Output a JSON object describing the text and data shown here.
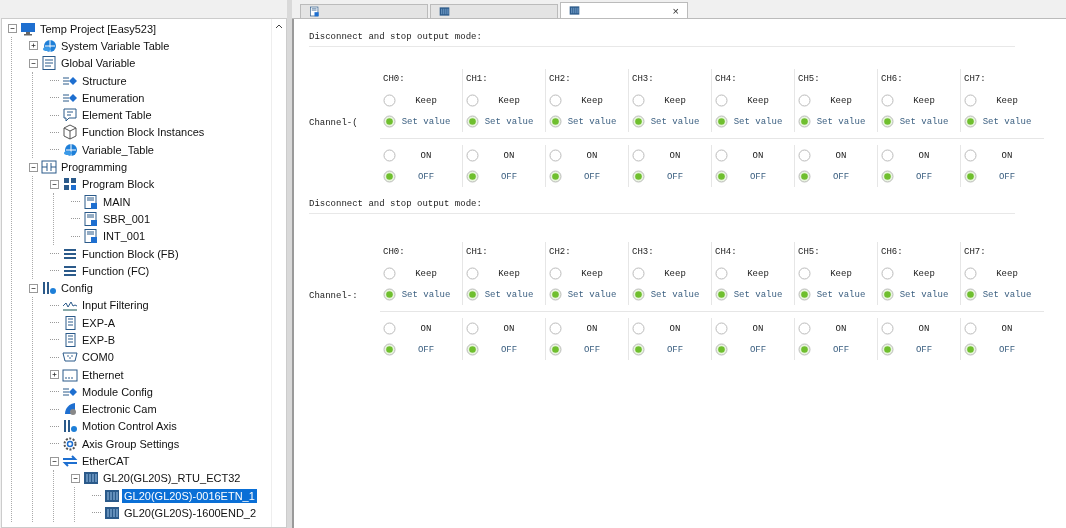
{
  "tabs": [
    {
      "selected": false
    },
    {
      "selected": false
    },
    {
      "selected": true,
      "close": "×"
    }
  ],
  "tree": [
    {
      "label": "Temp Project [Easy523]",
      "expanded": true,
      "selected": false,
      "children": [
        {
          "label": "System Variable Table",
          "expanded": false,
          "selected": false
        },
        {
          "label": "Global Variable",
          "expanded": true,
          "selected": false,
          "children": [
            {
              "label": "Structure",
              "selected": false
            },
            {
              "label": "Enumeration",
              "selected": false
            },
            {
              "label": "Element Table",
              "selected": false
            },
            {
              "label": "Function Block Instances",
              "selected": false
            },
            {
              "label": "Variable_Table",
              "selected": false
            }
          ]
        },
        {
          "label": "Programming",
          "expanded": true,
          "selected": false,
          "children": [
            {
              "label": "Program Block",
              "expanded": true,
              "selected": false,
              "children": [
                {
                  "label": "MAIN",
                  "selected": false
                },
                {
                  "label": "SBR_001",
                  "selected": false
                },
                {
                  "label": "INT_001",
                  "selected": false
                }
              ]
            },
            {
              "label": "Function Block (FB)",
              "selected": false
            },
            {
              "label": "Function (FC)",
              "selected": false
            }
          ]
        },
        {
          "label": "Config",
          "expanded": true,
          "selected": false,
          "children": [
            {
              "label": "Input Filtering",
              "selected": false
            },
            {
              "label": "EXP-A",
              "selected": false
            },
            {
              "label": "EXP-B",
              "selected": false
            },
            {
              "label": "COM0",
              "selected": false
            },
            {
              "label": "Ethernet",
              "expanded": false,
              "selected": false
            },
            {
              "label": "Module Config",
              "selected": false
            },
            {
              "label": "Electronic Cam",
              "selected": false
            },
            {
              "label": "Motion Control Axis",
              "selected": false
            },
            {
              "label": "Axis Group Settings",
              "selected": false
            },
            {
              "label": "EtherCAT",
              "expanded": true,
              "selected": false,
              "children": [
                {
                  "label": "GL20(GL20S)_RTU_ECT32",
                  "expanded": true,
                  "selected": false,
                  "children": [
                    {
                      "label": "GL20(GL20S)-0016ETN_1",
                      "selected": true
                    },
                    {
                      "label": "GL20(GL20S)-1600END_2",
                      "selected": false
                    }
                  ]
                }
              ]
            }
          ]
        }
      ]
    }
  ],
  "sections": [
    {
      "heading": "Disconnect and stop output mode:",
      "channel_label": "Channel-(",
      "channels": [
        {
          "name": "CH0:",
          "mode_options": [
            {
              "label": "Keep",
              "selected": false
            },
            {
              "label": "Set value",
              "selected": true
            }
          ],
          "output_options": [
            {
              "label": "ON",
              "selected": false
            },
            {
              "label": "OFF",
              "selected": true
            }
          ]
        },
        {
          "name": "CH1:",
          "mode_options": [
            {
              "label": "Keep",
              "selected": false
            },
            {
              "label": "Set value",
              "selected": true
            }
          ],
          "output_options": [
            {
              "label": "ON",
              "selected": false
            },
            {
              "label": "OFF",
              "selected": true
            }
          ]
        },
        {
          "name": "CH2:",
          "mode_options": [
            {
              "label": "Keep",
              "selected": false
            },
            {
              "label": "Set value",
              "selected": true
            }
          ],
          "output_options": [
            {
              "label": "ON",
              "selected": false
            },
            {
              "label": "OFF",
              "selected": true
            }
          ]
        },
        {
          "name": "CH3:",
          "mode_options": [
            {
              "label": "Keep",
              "selected": false
            },
            {
              "label": "Set value",
              "selected": true
            }
          ],
          "output_options": [
            {
              "label": "ON",
              "selected": false
            },
            {
              "label": "OFF",
              "selected": true
            }
          ]
        },
        {
          "name": "CH4:",
          "mode_options": [
            {
              "label": "Keep",
              "selected": false
            },
            {
              "label": "Set value",
              "selected": true
            }
          ],
          "output_options": [
            {
              "label": "ON",
              "selected": false
            },
            {
              "label": "OFF",
              "selected": true
            }
          ]
        },
        {
          "name": "CH5:",
          "mode_options": [
            {
              "label": "Keep",
              "selected": false
            },
            {
              "label": "Set value",
              "selected": true
            }
          ],
          "output_options": [
            {
              "label": "ON",
              "selected": false
            },
            {
              "label": "OFF",
              "selected": true
            }
          ]
        },
        {
          "name": "CH6:",
          "mode_options": [
            {
              "label": "Keep",
              "selected": false
            },
            {
              "label": "Set value",
              "selected": true
            }
          ],
          "output_options": [
            {
              "label": "ON",
              "selected": false
            },
            {
              "label": "OFF",
              "selected": true
            }
          ]
        },
        {
          "name": "CH7:",
          "mode_options": [
            {
              "label": "Keep",
              "selected": false
            },
            {
              "label": "Set value",
              "selected": true
            }
          ],
          "output_options": [
            {
              "label": "ON",
              "selected": false
            },
            {
              "label": "OFF",
              "selected": true
            }
          ]
        }
      ]
    },
    {
      "heading": "Disconnect and stop output mode:",
      "channel_label": "Channel-:",
      "channels": [
        {
          "name": "CH0:",
          "mode_options": [
            {
              "label": "Keep",
              "selected": false
            },
            {
              "label": "Set value",
              "selected": true
            }
          ],
          "output_options": [
            {
              "label": "ON",
              "selected": false
            },
            {
              "label": "OFF",
              "selected": true
            }
          ]
        },
        {
          "name": "CH1:",
          "mode_options": [
            {
              "label": "Keep",
              "selected": false
            },
            {
              "label": "Set value",
              "selected": true
            }
          ],
          "output_options": [
            {
              "label": "ON",
              "selected": false
            },
            {
              "label": "OFF",
              "selected": true
            }
          ]
        },
        {
          "name": "CH2:",
          "mode_options": [
            {
              "label": "Keep",
              "selected": false
            },
            {
              "label": "Set value",
              "selected": true
            }
          ],
          "output_options": [
            {
              "label": "ON",
              "selected": false
            },
            {
              "label": "OFF",
              "selected": true
            }
          ]
        },
        {
          "name": "CH3:",
          "mode_options": [
            {
              "label": "Keep",
              "selected": false
            },
            {
              "label": "Set value",
              "selected": true
            }
          ],
          "output_options": [
            {
              "label": "ON",
              "selected": false
            },
            {
              "label": "OFF",
              "selected": true
            }
          ]
        },
        {
          "name": "CH4:",
          "mode_options": [
            {
              "label": "Keep",
              "selected": false
            },
            {
              "label": "Set value",
              "selected": true
            }
          ],
          "output_options": [
            {
              "label": "ON",
              "selected": false
            },
            {
              "label": "OFF",
              "selected": true
            }
          ]
        },
        {
          "name": "CH5:",
          "mode_options": [
            {
              "label": "Keep",
              "selected": false
            },
            {
              "label": "Set value",
              "selected": true
            }
          ],
          "output_options": [
            {
              "label": "ON",
              "selected": false
            },
            {
              "label": "OFF",
              "selected": true
            }
          ]
        },
        {
          "name": "CH6:",
          "mode_options": [
            {
              "label": "Keep",
              "selected": false
            },
            {
              "label": "Set value",
              "selected": true
            }
          ],
          "output_options": [
            {
              "label": "ON",
              "selected": false
            },
            {
              "label": "OFF",
              "selected": true
            }
          ]
        },
        {
          "name": "CH7:",
          "mode_options": [
            {
              "label": "Keep",
              "selected": false
            },
            {
              "label": "Set value",
              "selected": true
            }
          ],
          "output_options": [
            {
              "label": "ON",
              "selected": false
            },
            {
              "label": "OFF",
              "selected": true
            }
          ]
        }
      ]
    }
  ]
}
